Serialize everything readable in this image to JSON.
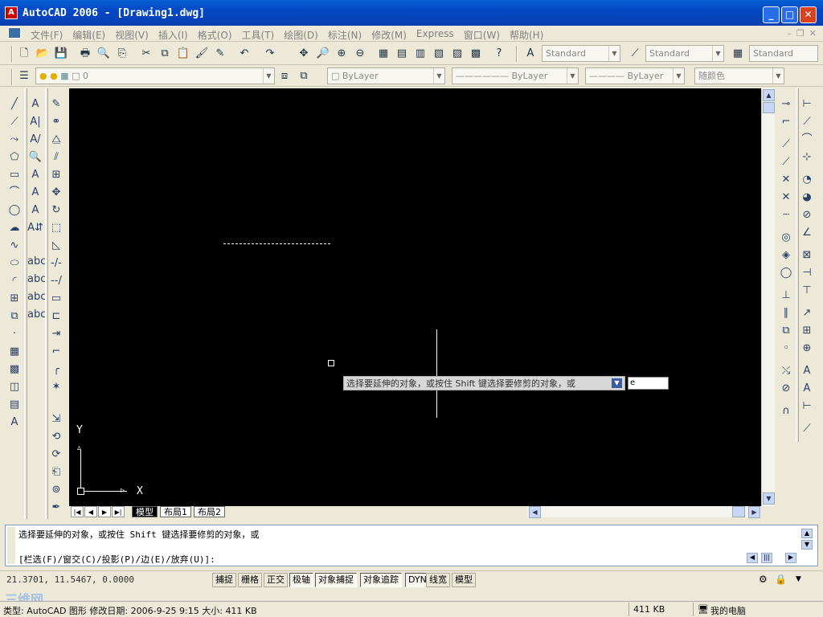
{
  "window": {
    "title": "AutoCAD 2006 - [Drawing1.dwg]",
    "minimize_icon": "minimize-icon",
    "maximize_icon": "maximize-icon",
    "close_icon": "close-icon"
  },
  "menu": {
    "items": [
      "文件(F)",
      "编辑(E)",
      "视图(V)",
      "插入(I)",
      "格式(O)",
      "工具(T)",
      "绘图(D)",
      "标注(N)",
      "修改(M)",
      "Express",
      "窗口(W)",
      "帮助(H)"
    ]
  },
  "styles": {
    "text_style": "Standard",
    "dim_style": "Standard",
    "table_style": "Standard"
  },
  "layers": {
    "current_layer": "0",
    "color": "ByLayer",
    "linetype": "ByLayer",
    "lineweight": "ByLayer",
    "plot_style": "随颜色"
  },
  "canvas": {
    "tooltip": "选择要延伸的对象，或按住 Shift 键选择要修剪的对象，或",
    "dyn_value": "e",
    "ucs_x": "X",
    "ucs_y": "Y"
  },
  "layout_tabs": [
    "模型",
    "布局1",
    "布局2"
  ],
  "command": {
    "line1": "选择要延伸的对象，或按住 Shift 键选择要修剪的对象，或",
    "line2": "[栏选(F)/窗交(C)/投影(P)/边(E)/放弃(U)]:"
  },
  "status": {
    "coordinates": "21.3701, 11.5467, 0.0000",
    "toggles": [
      "捕捉",
      "栅格",
      "正交",
      "极轴",
      "对象捕捉",
      "对象追踪",
      "DYN",
      "线宽",
      "模型"
    ]
  },
  "explorer": {
    "info": "类型: AutoCAD 图形 修改日期: 2006-9-25 9:15 大小: 411 KB",
    "size": "411 KB",
    "location": "我的电脑"
  },
  "watermark": "三维网"
}
